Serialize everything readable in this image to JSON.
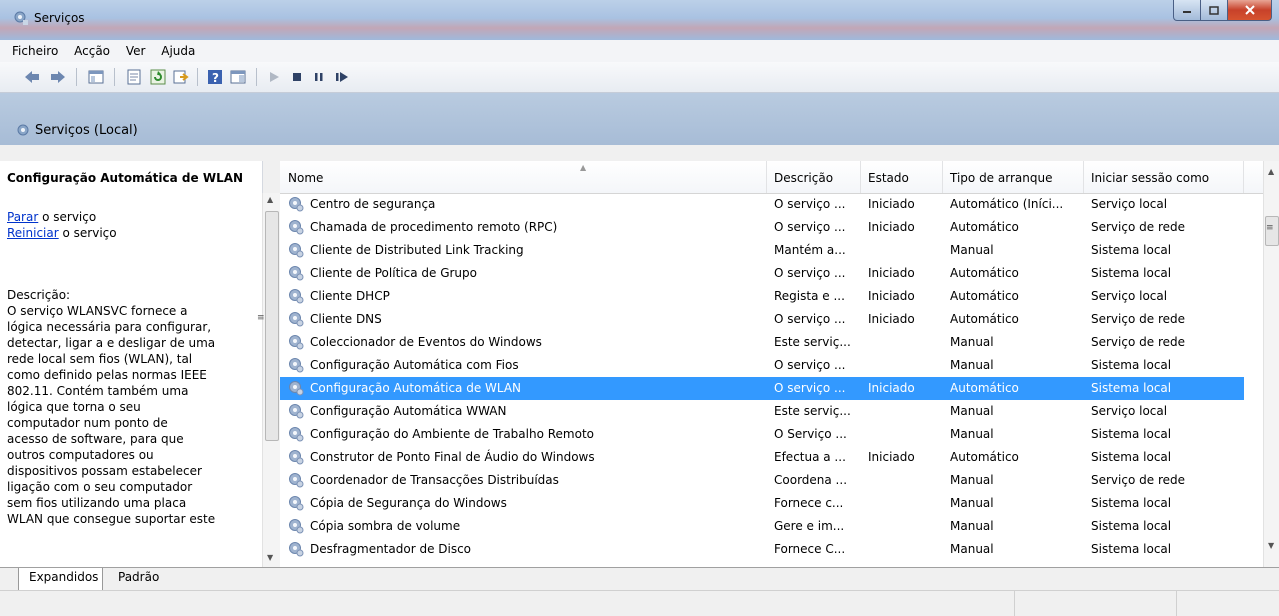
{
  "window": {
    "title": "Serviços"
  },
  "menu": [
    "Ficheiro",
    "Acção",
    "Ver",
    "Ajuda"
  ],
  "scope": {
    "label": "Serviços (Local)"
  },
  "left_pane": {
    "title": "Configuração Automática de WLAN",
    "stop_link": "Parar",
    "stop_suffix": " o serviço",
    "restart_link": "Reiniciar",
    "restart_suffix": " o serviço",
    "description_label": "Descrição:",
    "description_lines": [
      "O serviço WLANSVC fornece a",
      "lógica necessária para configurar,",
      "detectar, ligar a e desligar de uma",
      "rede local sem fios (WLAN), tal",
      "como definido pelas normas IEEE",
      "802.11. Contém também uma",
      "lógica que torna o seu",
      "computador num ponto de",
      "acesso de software, para que",
      "outros computadores ou",
      "dispositivos possam estabelecer",
      "ligação com o seu computador",
      "sem fios utilizando uma placa",
      "WLAN que consegue suportar este"
    ]
  },
  "columns": [
    "Nome",
    "Descrição",
    "Estado",
    "Tipo de arranque",
    "Iniciar sessão como"
  ],
  "rows": [
    [
      "Centro de segurança",
      "O serviço ...",
      "Iniciado",
      "Automático (Iníci...",
      "Serviço local"
    ],
    [
      "Chamada de procedimento remoto (RPC)",
      "O serviço ...",
      "Iniciado",
      "Automático",
      "Serviço de rede"
    ],
    [
      "Cliente de Distributed Link Tracking",
      "Mantém a...",
      "",
      "Manual",
      "Sistema local"
    ],
    [
      "Cliente de Política de Grupo",
      "O serviço ...",
      "Iniciado",
      "Automático",
      "Sistema local"
    ],
    [
      "Cliente DHCP",
      "Regista e ...",
      "Iniciado",
      "Automático",
      "Serviço local"
    ],
    [
      "Cliente DNS",
      "O serviço ...",
      "Iniciado",
      "Automático",
      "Serviço de rede"
    ],
    [
      "Coleccionador de Eventos do Windows",
      "Este serviç...",
      "",
      "Manual",
      "Serviço de rede"
    ],
    [
      "Configuração Automática com Fios",
      "O serviço ...",
      "",
      "Manual",
      "Sistema local"
    ],
    [
      "Configuração Automática de WLAN",
      "O serviço ...",
      "Iniciado",
      "Automático",
      "Sistema local"
    ],
    [
      "Configuração Automática WWAN",
      "Este serviç...",
      "",
      "Manual",
      "Serviço local"
    ],
    [
      "Configuração do Ambiente de Trabalho Remoto",
      "O Serviço ...",
      "",
      "Manual",
      "Sistema local"
    ],
    [
      "Construtor de Ponto Final de Áudio do Windows",
      "Efectua a ...",
      "Iniciado",
      "Automático",
      "Sistema local"
    ],
    [
      "Coordenador de Transacções Distribuídas",
      "Coordena ...",
      "",
      "Manual",
      "Serviço de rede"
    ],
    [
      "Cópia de Segurança do Windows",
      "Fornece c...",
      "",
      "Manual",
      "Sistema local"
    ],
    [
      "Cópia sombra de volume",
      "Gere e im...",
      "",
      "Manual",
      "Sistema local"
    ],
    [
      "Desfragmentador de Disco",
      "Fornece C...",
      "",
      "Manual",
      "Sistema local"
    ]
  ],
  "selected_row": "Configuração Automática de WLAN",
  "tabs": [
    "Expandidos",
    "Padrão"
  ],
  "colors": {
    "selection": "#3399ff",
    "link": "#0033cc",
    "scope_bar": "#b0c4dd"
  }
}
